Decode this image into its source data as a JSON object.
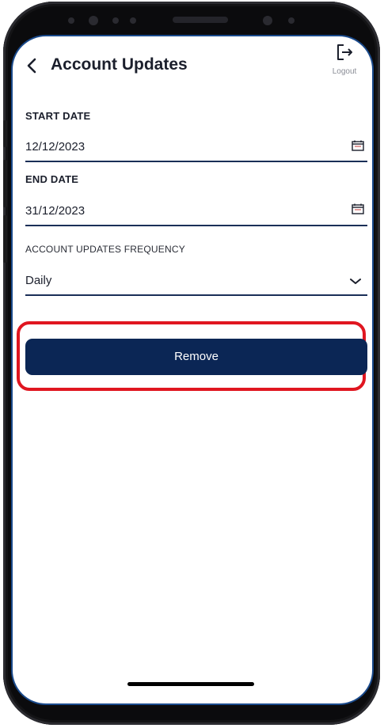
{
  "header": {
    "title": "Account Updates",
    "logout_label": "Logout",
    "back_icon": "chevron-left-icon",
    "logout_icon": "logout-icon"
  },
  "form": {
    "start_date": {
      "label": "START DATE",
      "value": "12/12/2023",
      "icon": "calendar-icon"
    },
    "end_date": {
      "label": "END DATE",
      "value": "31/12/2023",
      "icon": "calendar-icon"
    },
    "frequency": {
      "label": "ACCOUNT UPDATES FREQUENCY",
      "value": "Daily",
      "icon": "chevron-down-icon"
    }
  },
  "actions": {
    "remove_label": "Remove"
  },
  "colors": {
    "primary": "#0b2655",
    "highlight": "#e01620",
    "text": "#1b1f2c",
    "muted": "#8a8d96"
  }
}
